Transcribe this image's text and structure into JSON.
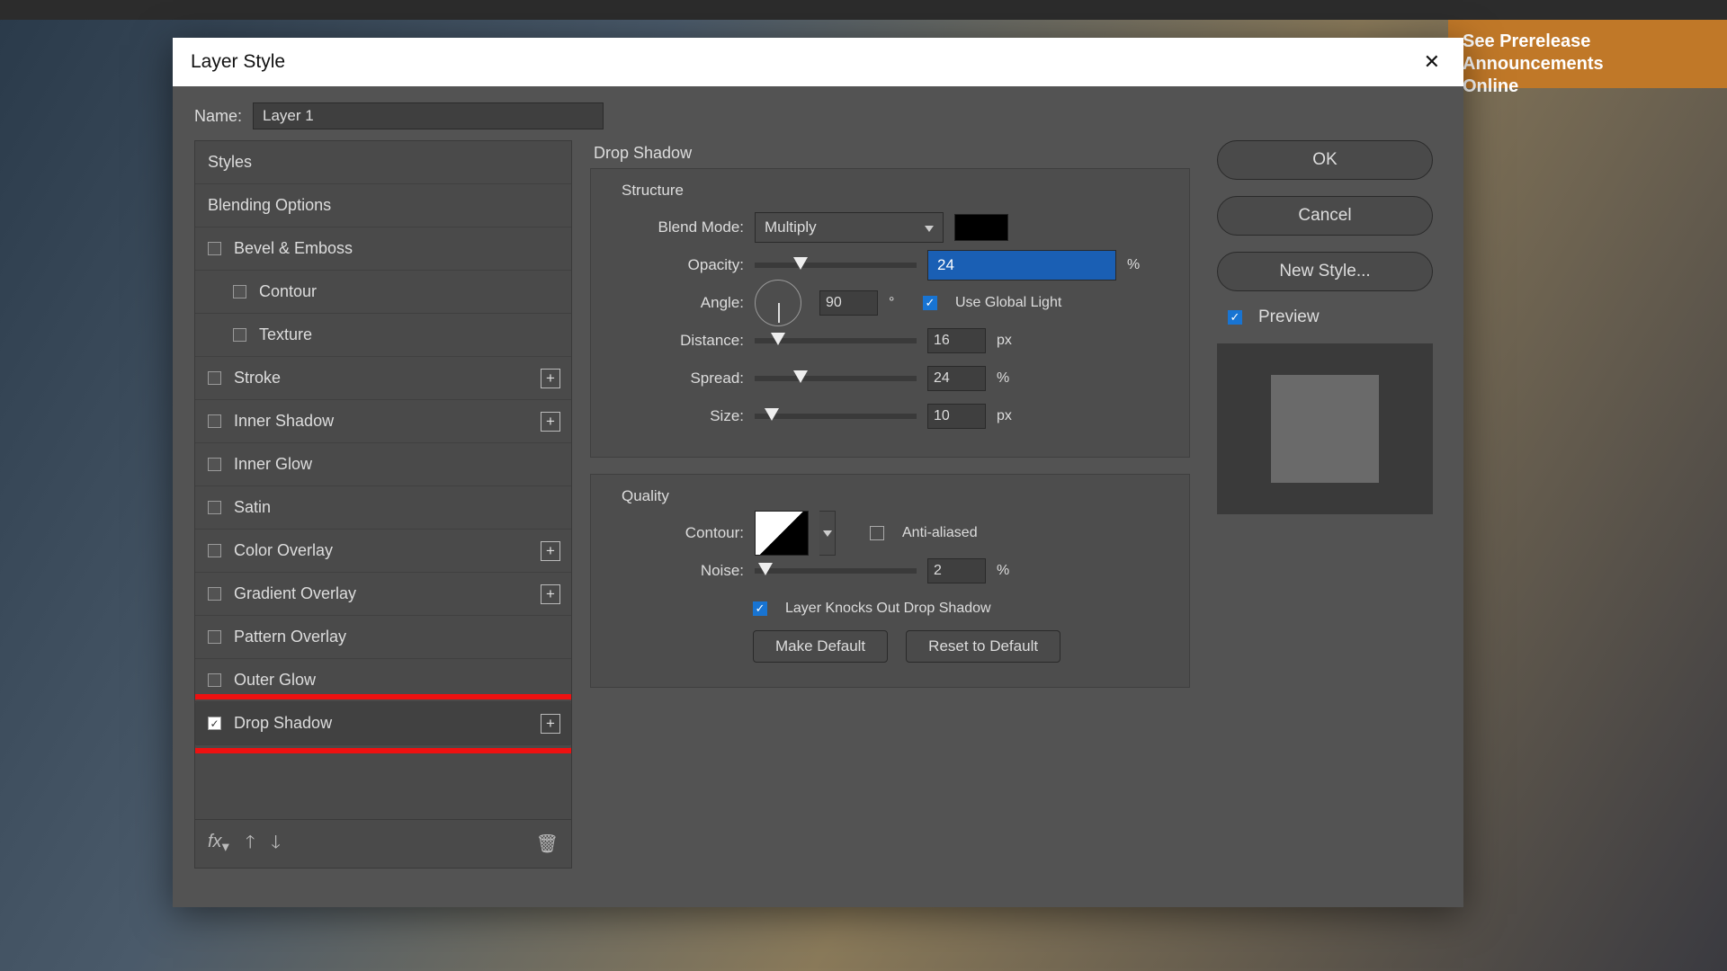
{
  "announce": {
    "line1": "See Prerelease Announcements",
    "line2": "Online"
  },
  "dialog": {
    "title": "Layer Style",
    "name_label": "Name:",
    "name_value": "Layer 1",
    "buttons": {
      "ok": "OK",
      "cancel": "Cancel",
      "new_style": "New Style...",
      "preview": "Preview"
    }
  },
  "styles": {
    "head1": "Styles",
    "head2": "Blending Options",
    "items": [
      {
        "label": "Bevel & Emboss",
        "checked": false,
        "plus": false,
        "indent": false
      },
      {
        "label": "Contour",
        "checked": false,
        "plus": false,
        "indent": true
      },
      {
        "label": "Texture",
        "checked": false,
        "plus": false,
        "indent": true
      },
      {
        "label": "Stroke",
        "checked": false,
        "plus": true,
        "indent": false
      },
      {
        "label": "Inner Shadow",
        "checked": false,
        "plus": true,
        "indent": false
      },
      {
        "label": "Inner Glow",
        "checked": false,
        "plus": false,
        "indent": false
      },
      {
        "label": "Satin",
        "checked": false,
        "plus": false,
        "indent": false
      },
      {
        "label": "Color Overlay",
        "checked": false,
        "plus": true,
        "indent": false
      },
      {
        "label": "Gradient Overlay",
        "checked": false,
        "plus": true,
        "indent": false
      },
      {
        "label": "Pattern Overlay",
        "checked": false,
        "plus": false,
        "indent": false
      },
      {
        "label": "Outer Glow",
        "checked": false,
        "plus": false,
        "indent": false
      },
      {
        "label": "Drop Shadow",
        "checked": true,
        "plus": true,
        "indent": false,
        "highlight": true
      }
    ]
  },
  "panel": {
    "title": "Drop Shadow",
    "structure": {
      "label": "Structure",
      "blend_mode_label": "Blend Mode:",
      "blend_mode_value": "Multiply",
      "color": "#000000",
      "opacity_label": "Opacity:",
      "opacity_value": "24",
      "opacity_unit": "%",
      "angle_label": "Angle:",
      "angle_value": "90",
      "angle_unit": "°",
      "global_light": "Use Global Light",
      "global_light_on": true,
      "distance_label": "Distance:",
      "distance_value": "16",
      "distance_unit": "px",
      "spread_label": "Spread:",
      "spread_value": "24",
      "spread_unit": "%",
      "size_label": "Size:",
      "size_value": "10",
      "size_unit": "px"
    },
    "quality": {
      "label": "Quality",
      "contour_label": "Contour:",
      "anti_aliased": "Anti-aliased",
      "anti_aliased_on": false,
      "noise_label": "Noise:",
      "noise_value": "2",
      "noise_unit": "%",
      "knockout": "Layer Knocks Out Drop Shadow",
      "knockout_on": true,
      "make_default": "Make Default",
      "reset_default": "Reset to Default"
    }
  }
}
